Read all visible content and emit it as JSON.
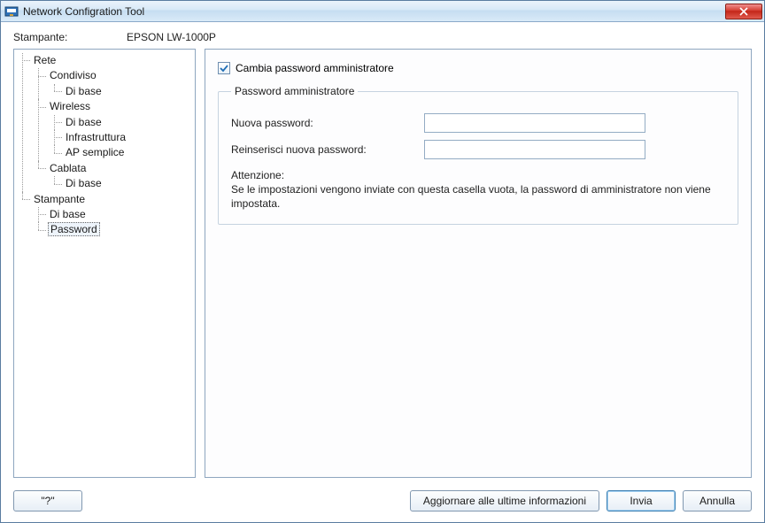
{
  "window": {
    "title": "Network Configration Tool"
  },
  "header": {
    "printer_label": "Stampante:",
    "printer_value": "EPSON LW-1000P"
  },
  "tree": {
    "rete": "Rete",
    "condiviso": "Condiviso",
    "condiviso_base": "Di base",
    "wireless": "Wireless",
    "wireless_base": "Di base",
    "wireless_infra": "Infrastruttura",
    "wireless_ap": "AP semplice",
    "cablata": "Cablata",
    "cablata_base": "Di base",
    "stampante": "Stampante",
    "stampante_base": "Di base",
    "stampante_password": "Password"
  },
  "panel": {
    "checkbox_label": "Cambia password amministratore",
    "group_legend": "Password amministratore",
    "new_pw_label": "Nuova password:",
    "new_pw_value": "",
    "confirm_pw_label": "Reinserisci nuova password:",
    "confirm_pw_value": "",
    "warn_title": "Attenzione:",
    "warn_body": "Se le impostazioni vengono inviate con questa casella vuota, la password di amministratore non viene impostata."
  },
  "buttons": {
    "help": "\"?\"",
    "refresh": "Aggiornare alle ultime informazioni",
    "send": "Invia",
    "cancel": "Annulla"
  }
}
